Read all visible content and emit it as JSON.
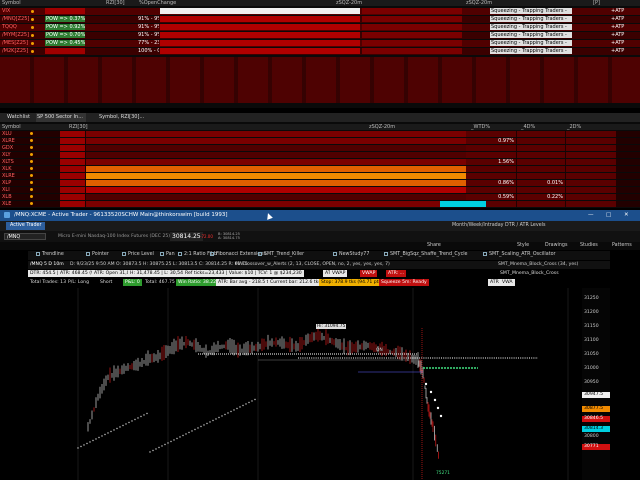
{
  "watchlist_top": {
    "header": [
      "Symbol",
      "RZI[30]",
      "%OpenChange",
      "zSQZ-20m",
      "zSQZ-20m",
      "[P]"
    ],
    "rows": [
      {
        "symbol": "VIX",
        "col2": "",
        "col3": "",
        "col4": "",
        "status": "Squeezing - Trapping Traders -",
        "tag": "+ATP"
      },
      {
        "symbol": "/MNQ[Z25]",
        "col2": "POW => 0.37%",
        "col3": "91% - 9%",
        "col4": "",
        "status": "Squeezing - Trapping Traders -",
        "tag": "+ATP"
      },
      {
        "symbol": "TQQQ",
        "col2": "POW => 0.92%",
        "col3": "91% - 9%",
        "col4": "",
        "status": "Squeezing - Trapping Traders -",
        "tag": "+ATP"
      },
      {
        "symbol": "/MYM[Z25]",
        "col2": "POW => 0.70%",
        "col3": "91% - 9%",
        "col4": "",
        "status": "Squeezing - Trapping Traders -",
        "tag": "+ATP"
      },
      {
        "symbol": "/MES[Z25]",
        "col2": "POW => 0.45%",
        "col3": "77% - 23%",
        "col4": "",
        "status": "Squeezing - Trapping Traders -",
        "tag": "+ATP"
      },
      {
        "symbol": "/M2K[Z25]",
        "col2": "",
        "col3": "100% - 0%",
        "col4": "",
        "status": "Squeezing - Trapping Traders -",
        "tag": "+ATP"
      }
    ]
  },
  "watchlist_mid": {
    "tab_label": "Watchlist",
    "list_name": "SP 500 Sector In...",
    "symbol_col": "Symbol, RZI[30]...",
    "header": [
      "Symbol",
      "RZI[30]",
      "zSQZ-20m",
      "_WTD%",
      "_4D%",
      "_2D%"
    ],
    "symbols": [
      "XLU",
      "XLRE",
      "GDX",
      "XLY",
      "XLTS",
      "XLK",
      "XLRE",
      "XLP",
      "XLI",
      "XLB",
      "XLE"
    ],
    "values": [
      [
        "",
        "",
        ""
      ],
      [
        "",
        "0.97%",
        ""
      ],
      [
        "",
        "",
        ""
      ],
      [
        "",
        "",
        ""
      ],
      [
        "",
        "1.56%",
        ""
      ],
      [
        "",
        "",
        ""
      ],
      [
        "",
        "",
        ""
      ],
      [
        "",
        "0.86%",
        "0.01%"
      ],
      [
        "",
        "",
        ""
      ],
      [
        "",
        "0.59%",
        "0.22%"
      ],
      [
        "",
        "",
        ""
      ]
    ]
  },
  "window": {
    "title": "/MNQ:XCME - Active Trader - 96133520SCHW Main@thinkorswim [build 1993]",
    "tab": "Active Trader",
    "symbol_input": "/MNQ",
    "description": "Micro E-mini Nasdaq-100 Index Futures (DEC 25)",
    "last_price": "30814.25",
    "change": "-72.00",
    "bid_label": "B: 30814.25",
    "ask_label": "A: 30814.75",
    "layout_label": "Month/Week/Intraday DTR / ATR Levels"
  },
  "action_bar": {
    "share": "Share",
    "style": "Style",
    "drawings": "Drawings",
    "studies": "Studies",
    "patterns": "Patterns"
  },
  "drawing_tools": [
    {
      "name": "Trendline"
    },
    {
      "name": "Pointer"
    },
    {
      "name": "Price Level"
    },
    {
      "name": "Pan"
    },
    {
      "name": "2:1 Ratio Fibb"
    },
    {
      "name": "Fibonacci Extensions"
    },
    {
      "name": "SMT_Trend_Killer"
    },
    {
      "name": "NewStudy77"
    },
    {
      "name": "SMT_BigSqz_Shaffe_Trend_Cycle"
    },
    {
      "name": "SMT_Scaling_ATR_Oscillator"
    }
  ],
  "chart_header": {
    "symbol_tf": "/MNQ 5 D 10m",
    "info": "D: 9/23/25 9:50 AM  O: 30873.5  H: 30875.25  L: 30813.5  C: 30814.25  R: 61.75",
    "study": "MACrossover_w_Alerts (2, 13, CLOSE, OPEN, no, 2, yes, yes, yes, 7)",
    "right_tag": "SMT_Mnema_Block_Cross (34, yes)"
  },
  "study_row1": [
    {
      "text": "DTR: 454.5 | ATR: 468.45 (97%)",
      "color": "white"
    },
    {
      "text": "ATR: Open 31,051",
      "color": "white"
    },
    {
      "text": "H: 31,478.45 | L: 30,541.55",
      "color": "white"
    },
    {
      "text": "Ref ticks=23,433 | Value: $10 | TCV: 1 @ $234,230",
      "color": "white"
    },
    {
      "text": "ATP",
      "color": "white"
    },
    {
      "text": "VWAP",
      "color": "white"
    },
    {
      "text": "VWAP",
      "color": "red"
    },
    {
      "text": "ATR: ...",
      "color": "red"
    },
    {
      "text": "SMT_Mnema_Block_Cross",
      "color": "none"
    }
  ],
  "study_row2": [
    {
      "text": "Total Trades: 13",
      "color": "none"
    },
    {
      "text": "P/L: Long",
      "color": "none"
    },
    {
      "text": "Short",
      "color": "none"
    },
    {
      "text": "P&L: 0",
      "color": "green"
    },
    {
      "text": "Total: 467.75",
      "color": "none"
    },
    {
      "text": "Win Ratio: 38.22%",
      "color": "green"
    },
    {
      "text": "ATR: Bar avg - 218.5 tks",
      "color": "white"
    },
    {
      "text": "Current bar: 212.6 tks",
      "color": "white"
    },
    {
      "text": "Stop: 378.9 tks (94.71 pts)",
      "color": "orange"
    },
    {
      "text": "Squeeze 5m: Ready",
      "color": "red"
    },
    {
      "text": "ATR",
      "color": "white"
    },
    {
      "text": "VWA",
      "color": "white"
    }
  ],
  "chart_annotations": {
    "hi_label": "Hi: 31094.75",
    "lo_label": "75271",
    "on_label": "ON"
  },
  "price_axis": [
    {
      "price": "31250",
      "kind": "plain"
    },
    {
      "price": "31200",
      "kind": "plain"
    },
    {
      "price": "31150",
      "kind": "plain"
    },
    {
      "price": "31100",
      "kind": "plain"
    },
    {
      "price": "31050",
      "kind": "plain"
    },
    {
      "price": "31000",
      "kind": "plain"
    },
    {
      "price": "30950",
      "kind": "plain"
    },
    {
      "price": "30947.5",
      "kind": "white"
    },
    {
      "price": "30877.5",
      "kind": "orange"
    },
    {
      "price": "30846.5",
      "kind": "red"
    },
    {
      "price": "30814.3",
      "kind": "cyan"
    },
    {
      "price": "30800",
      "kind": "plain"
    },
    {
      "price": "30771",
      "kind": "red"
    }
  ],
  "colors": {
    "accent_blue": "#1c4f8c",
    "candle_up": "#ffffff",
    "candle_down": "#ff2020",
    "signal_green": "#40e080"
  }
}
